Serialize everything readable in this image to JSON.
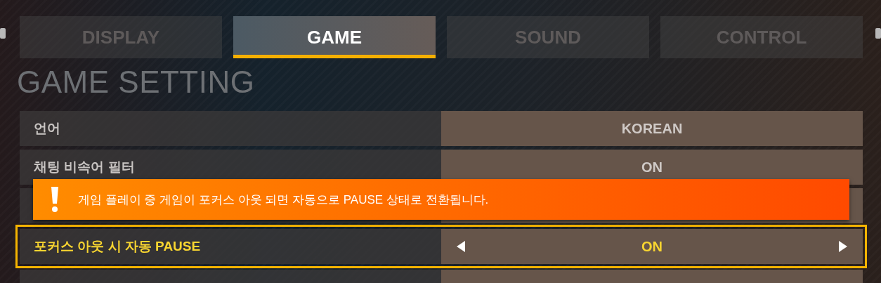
{
  "tabs": [
    {
      "label": "DISPLAY",
      "selected": false
    },
    {
      "label": "GAME",
      "selected": true
    },
    {
      "label": "SOUND",
      "selected": false
    },
    {
      "label": "CONTROL",
      "selected": false
    }
  ],
  "heading": "GAME SETTING",
  "settings": [
    {
      "kind": "option",
      "label": "언어",
      "value": "KOREAN",
      "selected": false
    },
    {
      "kind": "option",
      "label": "채팅 비속어 필터",
      "value": "ON",
      "selected": false
    },
    {
      "kind": "covered",
      "selected": false
    },
    {
      "kind": "option",
      "label": "포커스 아웃 시 자동 PAUSE",
      "value": "ON",
      "selected": true
    },
    {
      "kind": "covered",
      "selected": false
    }
  ],
  "notice": {
    "text": "게임 플레이 중 게임이 포커스 아웃 되면 자동으로 PAUSE 상태로 전환됩니다."
  }
}
